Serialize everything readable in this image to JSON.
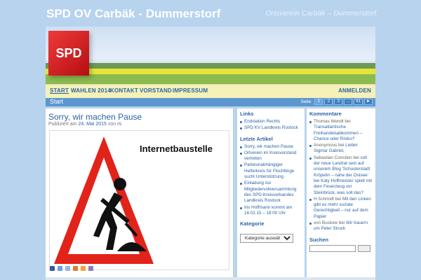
{
  "site": {
    "title": "SPD OV Carbäk - Dummerstorf",
    "tagline": "Ortsverein Carbäk – Dummerstorf",
    "logo_text": "SPD"
  },
  "nav": {
    "items": [
      "START",
      "WAHLEN 2014",
      "KONTAKT",
      "VORSTAND",
      "IMPRESSUM"
    ],
    "login": "ANMELDEN"
  },
  "breadcrumb": "Start",
  "pager": {
    "label": "Seite",
    "pages": [
      "1",
      "2",
      "3",
      "...",
      "61",
      "►"
    ],
    "current": "1"
  },
  "post": {
    "title": "Sorry, wir machen Pause",
    "meta_prefix": "Publiziert am",
    "date": "24. Mai 2015",
    "meta_by": "von",
    "author": "rs",
    "image_text": "Internetbaustelle"
  },
  "sidebar_left": {
    "links_heading": "Links",
    "links": [
      "Endstation Rechts",
      "SPD KV Landkreis Rostock"
    ],
    "articles_heading": "Letzte Artikel",
    "articles": [
      "Sorry, wir machen Pause",
      "Ortverein im Kreisvorstand vertreten",
      "Parteiunabhängiger Helferkreis für Flüchtlinge sucht Unterstützung",
      "Einladung zur Mitgliedervollversammlung des SPD-Kreisverbandes Landkreis Rostock",
      "Iris Hoffmann kommt am 18.02.15 – 18:00 Uhr"
    ],
    "category_heading": "Kategorie",
    "category_select": "Kategorie auswählen"
  },
  "sidebar_right": {
    "comments_heading": "Kommentare",
    "comments": [
      {
        "who": "Thomas Wendt",
        "on": "bei",
        "post": "Transatlantische Freihandelsabkommen – Chance oder Risiko?"
      },
      {
        "who": "Anonymous",
        "on": "bei",
        "post": "Lieber Sigmar Gabriel,"
      },
      {
        "who": "Sebastian Constien",
        "on": "bei",
        "post": "soll der neue Landrat sein auf unserem Blog 'Schusterstadt Kröpelin – nahe der Ostsee' bei Katy Hoffmeister spielt mit dem Feuerzeug vor Steinbrück, was soll das?"
      },
      {
        "who": "H.Schmidt",
        "on": "bei",
        "post": "Mit den Linken gibt es mehr soziale Gerechtigkeit – nur auf dem Papier"
      },
      {
        "who": "von Buckow",
        "on": "bei",
        "post": "Wir trauern um Peter Struck"
      }
    ],
    "search_heading": "Suchen"
  },
  "colors": {
    "background": "#b7d3ee",
    "link": "#2c64a6",
    "nav_bg": "#f4f1b9",
    "crumb_bg": "#5c97d0",
    "spd_red": "#e2231a"
  }
}
